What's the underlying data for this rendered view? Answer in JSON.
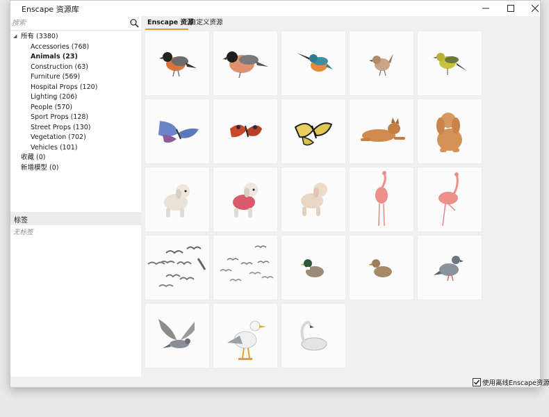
{
  "window": {
    "title": "Enscape 资源库"
  },
  "search": {
    "placeholder": "搜索"
  },
  "tree": {
    "root": {
      "label": "所有 (3380)"
    },
    "categories": [
      {
        "label": "Accessories (768)"
      },
      {
        "label": "Animals (23)",
        "selected": true
      },
      {
        "label": "Construction (63)"
      },
      {
        "label": "Furniture (569)"
      },
      {
        "label": "Hospital Props (120)"
      },
      {
        "label": "Lighting (206)"
      },
      {
        "label": "People (570)"
      },
      {
        "label": "Sport Props (128)"
      },
      {
        "label": "Street Props (130)"
      },
      {
        "label": "Vegetation (702)"
      },
      {
        "label": "Vehicles (101)"
      }
    ],
    "favorites": {
      "label": "收藏 (0)"
    },
    "new_models": {
      "label": "新增模型 (0)"
    }
  },
  "tags": {
    "header": "标签",
    "empty": "无标签"
  },
  "tabs": [
    {
      "label": "Enscape 资源",
      "active": true
    },
    {
      "label": "自定义资源",
      "active": false
    }
  ],
  "assets": [
    {
      "icon": "bullfinch-bird-icon"
    },
    {
      "icon": "bullfinch-bird-icon"
    },
    {
      "icon": "kingfisher-bird-icon"
    },
    {
      "icon": "wren-bird-icon"
    },
    {
      "icon": "yellow-bird-icon"
    },
    {
      "icon": "blue-butterfly-icon"
    },
    {
      "icon": "red-butterfly-icon"
    },
    {
      "icon": "swallowtail-butterfly-icon"
    },
    {
      "icon": "dog-lying-icon"
    },
    {
      "icon": "spaniel-dog-icon"
    },
    {
      "icon": "poodle-dog-icon"
    },
    {
      "icon": "poodle-sweater-dog-icon"
    },
    {
      "icon": "poodle-dog-icon"
    },
    {
      "icon": "flamingo-icon"
    },
    {
      "icon": "flamingo-icon"
    },
    {
      "icon": "bird-flock-icon"
    },
    {
      "icon": "bird-flock-icon"
    },
    {
      "icon": "mallard-duck-icon"
    },
    {
      "icon": "female-duck-icon"
    },
    {
      "icon": "pigeon-icon"
    },
    {
      "icon": "flying-pigeon-icon"
    },
    {
      "icon": "seagull-icon"
    },
    {
      "icon": "swan-icon"
    }
  ],
  "offline": {
    "label": "使用离线Enscape资源",
    "checked": true
  },
  "colors": {
    "accent": "#e8962a",
    "tile_bg": "#fbfbfb",
    "pane_bg": "#ffffff",
    "window_bg": "#f0f0f0"
  }
}
